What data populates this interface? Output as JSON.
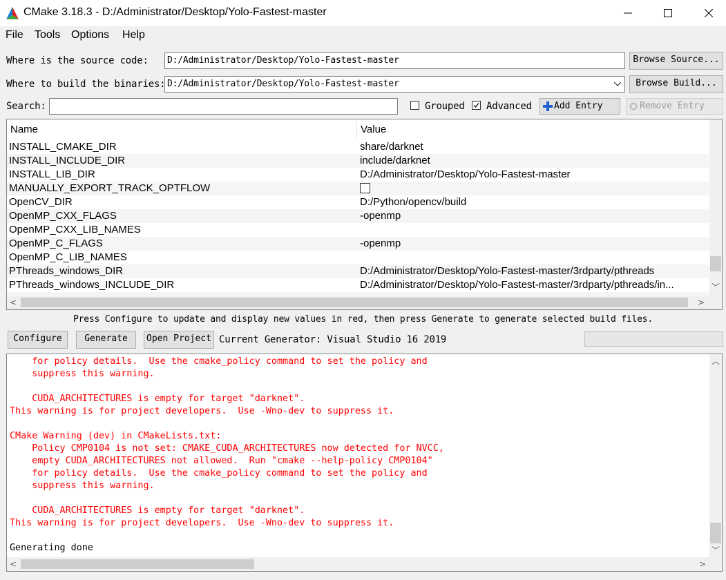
{
  "window": {
    "title": "CMake 3.18.3 - D:/Administrator/Desktop/Yolo-Fastest-master",
    "minimize_glyph": "—",
    "maximize_glyph": "☐",
    "close_glyph": "✕"
  },
  "menu": [
    "File",
    "Tools",
    "Options",
    "Help"
  ],
  "source": {
    "label": "Where is the source code:",
    "value": "D:/Administrator/Desktop/Yolo-Fastest-master",
    "button": "Browse Source..."
  },
  "build": {
    "label": "Where to build the binaries:",
    "value": "D:/Administrator/Desktop/Yolo-Fastest-master",
    "button": "Browse Build..."
  },
  "search": {
    "label": "Search:",
    "value": "",
    "grouped_label": "Grouped",
    "grouped_checked": false,
    "advanced_label": "Advanced",
    "advanced_checked": true,
    "add_entry": "Add Entry",
    "remove_entry": "Remove Entry"
  },
  "table": {
    "columns": [
      "Name",
      "Value"
    ],
    "rows": [
      {
        "name": "INSTALL_CMAKE_DIR",
        "value": "share/darknet"
      },
      {
        "name": "INSTALL_INCLUDE_DIR",
        "value": "include/darknet"
      },
      {
        "name": "INSTALL_LIB_DIR",
        "value": "D:/Administrator/Desktop/Yolo-Fastest-master"
      },
      {
        "name": "MANUALLY_EXPORT_TRACK_OPTFLOW",
        "value": "",
        "checkbox": true
      },
      {
        "name": "OpenCV_DIR",
        "value": "D:/Python/opencv/build"
      },
      {
        "name": "OpenMP_CXX_FLAGS",
        "value": "-openmp"
      },
      {
        "name": "OpenMP_CXX_LIB_NAMES",
        "value": ""
      },
      {
        "name": "OpenMP_C_FLAGS",
        "value": "-openmp"
      },
      {
        "name": "OpenMP_C_LIB_NAMES",
        "value": ""
      },
      {
        "name": "PThreads_windows_DIR",
        "value": "D:/Administrator/Desktop/Yolo-Fastest-master/3rdparty/pthreads"
      },
      {
        "name": "PThreads_windows_INCLUDE_DIR",
        "value": "D:/Administrator/Desktop/Yolo-Fastest-master/3rdparty/pthreads/in..."
      }
    ]
  },
  "hint": "Press Configure to update and display new values in red, then press Generate to generate selected build files.",
  "actions": {
    "configure": "Configure",
    "generate": "Generate",
    "open_project": "Open Project",
    "generator": "Current Generator: Visual Studio 16 2019"
  },
  "output": {
    "red_color": "#ff0000",
    "lines": [
      {
        "text": "    for policy details.  Use the cmake_policy command to set the policy and",
        "color": "red"
      },
      {
        "text": "    suppress this warning.",
        "color": "red"
      },
      {
        "text": "",
        "color": "red"
      },
      {
        "text": "    CUDA_ARCHITECTURES is empty for target \"darknet\".",
        "color": "red"
      },
      {
        "text": "This warning is for project developers.  Use -Wno-dev to suppress it.",
        "color": "red"
      },
      {
        "text": "",
        "color": "red"
      },
      {
        "text": "CMake Warning (dev) in CMakeLists.txt:",
        "color": "red"
      },
      {
        "text": "    Policy CMP0104 is not set: CMAKE_CUDA_ARCHITECTURES now detected for NVCC,",
        "color": "red"
      },
      {
        "text": "    empty CUDA_ARCHITECTURES not allowed.  Run \"cmake --help-policy CMP0104\"",
        "color": "red"
      },
      {
        "text": "    for policy details.  Use the cmake_policy command to set the policy and",
        "color": "red"
      },
      {
        "text": "    suppress this warning.",
        "color": "red"
      },
      {
        "text": "",
        "color": "red"
      },
      {
        "text": "    CUDA_ARCHITECTURES is empty for target \"darknet\".",
        "color": "red"
      },
      {
        "text": "This warning is for project developers.  Use -Wno-dev to suppress it.",
        "color": "red"
      },
      {
        "text": "",
        "color": "black"
      },
      {
        "text": "Generating done",
        "color": "black"
      }
    ]
  }
}
